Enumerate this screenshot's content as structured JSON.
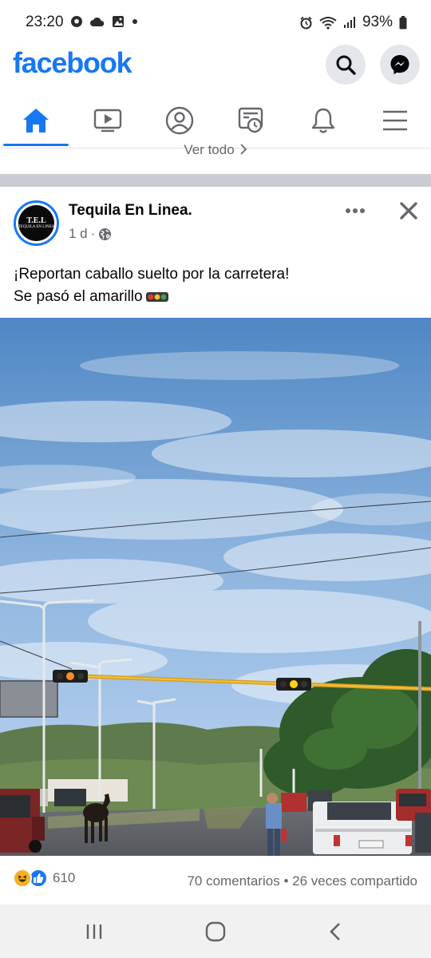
{
  "status_bar": {
    "time": "23:20",
    "battery": "93%"
  },
  "header": {
    "logo": "facebook"
  },
  "feed": {
    "see_all": "Ver todo"
  },
  "post": {
    "page_name": "Tequila En Linea.",
    "avatar_text_big": "T.E.L",
    "avatar_text_small": "TEQUILA EN LINEA",
    "age": "1 d",
    "separator": "·",
    "text_line1": "¡Reportan caballo suelto por la carretera!",
    "text_line2": "Se pasó el amarillo",
    "reaction_count": "610",
    "comments": "70 comentarios",
    "shares": "26 veces compartido",
    "engagement_separator": "•"
  },
  "colors": {
    "brand": "#1877f2",
    "muted": "#65676b",
    "divider": "#c9ccd1"
  },
  "icons": [
    "search-icon",
    "messenger-icon",
    "home-icon",
    "video-icon",
    "profile-icon",
    "news-icon",
    "bell-icon",
    "menu-icon",
    "globe-icon",
    "more-icon",
    "close-icon"
  ]
}
